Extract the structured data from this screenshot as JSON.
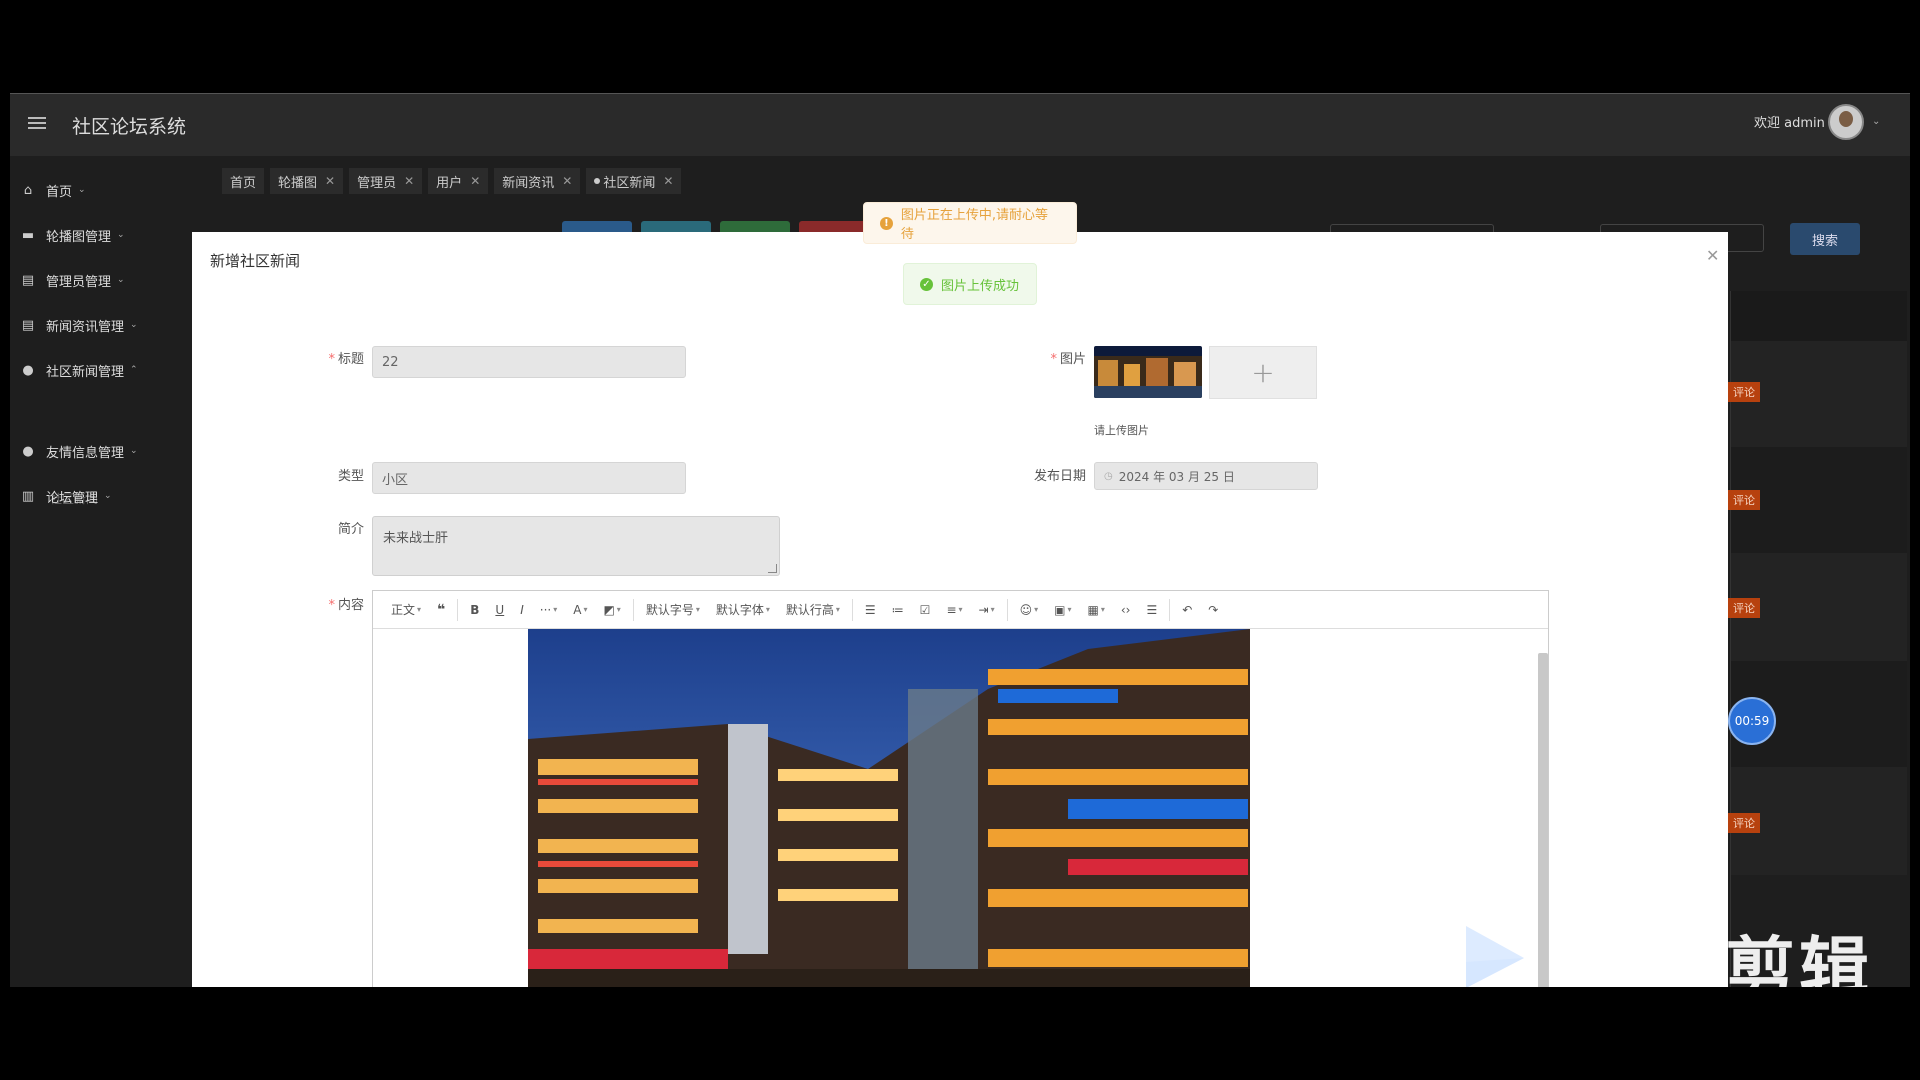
{
  "app": {
    "title": "社区论坛系统",
    "welcome": "欢迎 admin"
  },
  "sidebar": {
    "items": [
      {
        "label": "首页",
        "icon": "home-icon"
      },
      {
        "label": "轮播图管理",
        "icon": "carousel-icon"
      },
      {
        "label": "管理员管理",
        "icon": "admin-icon"
      },
      {
        "label": "新闻资讯管理",
        "icon": "news-icon"
      },
      {
        "label": "社区新闻管理",
        "icon": "community-icon"
      },
      {
        "label": "友情信息管理",
        "icon": "link-icon"
      },
      {
        "label": "论坛管理",
        "icon": "forum-icon"
      }
    ],
    "sub_item": "社区新闻"
  },
  "tabs": [
    "首页",
    "轮播图",
    "管理员",
    "用户",
    "新闻资讯",
    "社区新闻"
  ],
  "search_button": "搜索",
  "right_badges": [
    "评论",
    "评论",
    "评论",
    "评论"
  ],
  "timer": "00:59",
  "watermark": "剪辑",
  "toasts": {
    "warning": "图片正在上传中,请耐心等待",
    "success": "图片上传成功"
  },
  "dialog": {
    "title": "新增社区新闻",
    "fields": {
      "title": {
        "label": "标题",
        "value": "22"
      },
      "image": {
        "label": "图片",
        "hint": "请上传图片"
      },
      "type": {
        "label": "类型",
        "value": "小区"
      },
      "date": {
        "label": "发布日期",
        "value": "2024 年 03 月 25 日"
      },
      "intro": {
        "label": "简介",
        "value": "未来战士肝"
      },
      "content": {
        "label": "内容"
      }
    }
  },
  "editor_toolbar": {
    "paragraph": "正文",
    "font_size": "默认字号",
    "font_family": "默认字体",
    "line_height": "默认行高"
  },
  "colors": {
    "accent_blue": "#2a4a6e",
    "danger": "#b7410e",
    "required": "#f56c6c"
  }
}
